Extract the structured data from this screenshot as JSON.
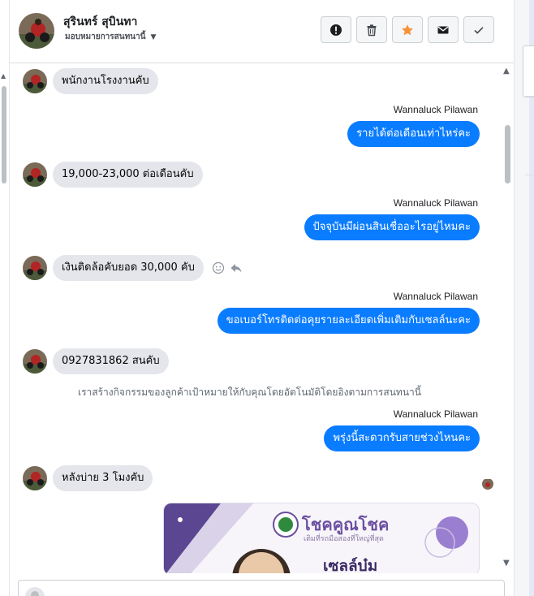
{
  "header": {
    "name": "สุรินทร์ สุบินทา",
    "subtitle": "มอบหมายการสนทนานี้"
  },
  "actions": [
    {
      "icon": "exclamation-icon"
    },
    {
      "icon": "trash-icon"
    },
    {
      "icon": "star-icon"
    },
    {
      "icon": "envelope-icon"
    },
    {
      "icon": "check-icon"
    }
  ],
  "colors": {
    "outgoing_bubble": "#0a7cff",
    "incoming_bubble": "#e4e6eb",
    "star": "#f7923b"
  },
  "messages": {
    "m1": "พนักงานโรงงานคับ",
    "s1": "Wannaluck Pilawan",
    "o1": "รายได้ต่อเดือนเท่าไหร่คะ",
    "m2": "19,000-23,000 ต่อเดือนคับ",
    "s2": "Wannaluck Pilawan",
    "o2": "ปัจจุบันมีผ่อนสินเชื่ออะไรอยู่ไหมคะ",
    "m3": "เงินติดล้อคับยอด 30,000 คับ",
    "s3": "Wannaluck Pilawan",
    "o3": "ขอเบอร์โทรติดต่อคุยรายละเอียดเพิ่มเติมกับเซลล์นะคะ",
    "m4": "0927831862 สนคับ",
    "system": "เราสร้างกิจกรรมของลูกค้าเป้าหมายให้กับคุณโดยอัตโนมัติโดยอิงตามการสนทนานี้",
    "s4": "Wannaluck Pilawan",
    "o4": "พรุ่งนี้สะดวกรับสายช่วงไหนคะ",
    "m5": "หลังบ่าย 3 โมงคับ"
  },
  "image_card": {
    "brand": "โชคคูณโชค",
    "tagline": "เติมที่รถมือสองที่ใหญ่ที่สุด",
    "name": "เซลล์บ๋ม"
  }
}
